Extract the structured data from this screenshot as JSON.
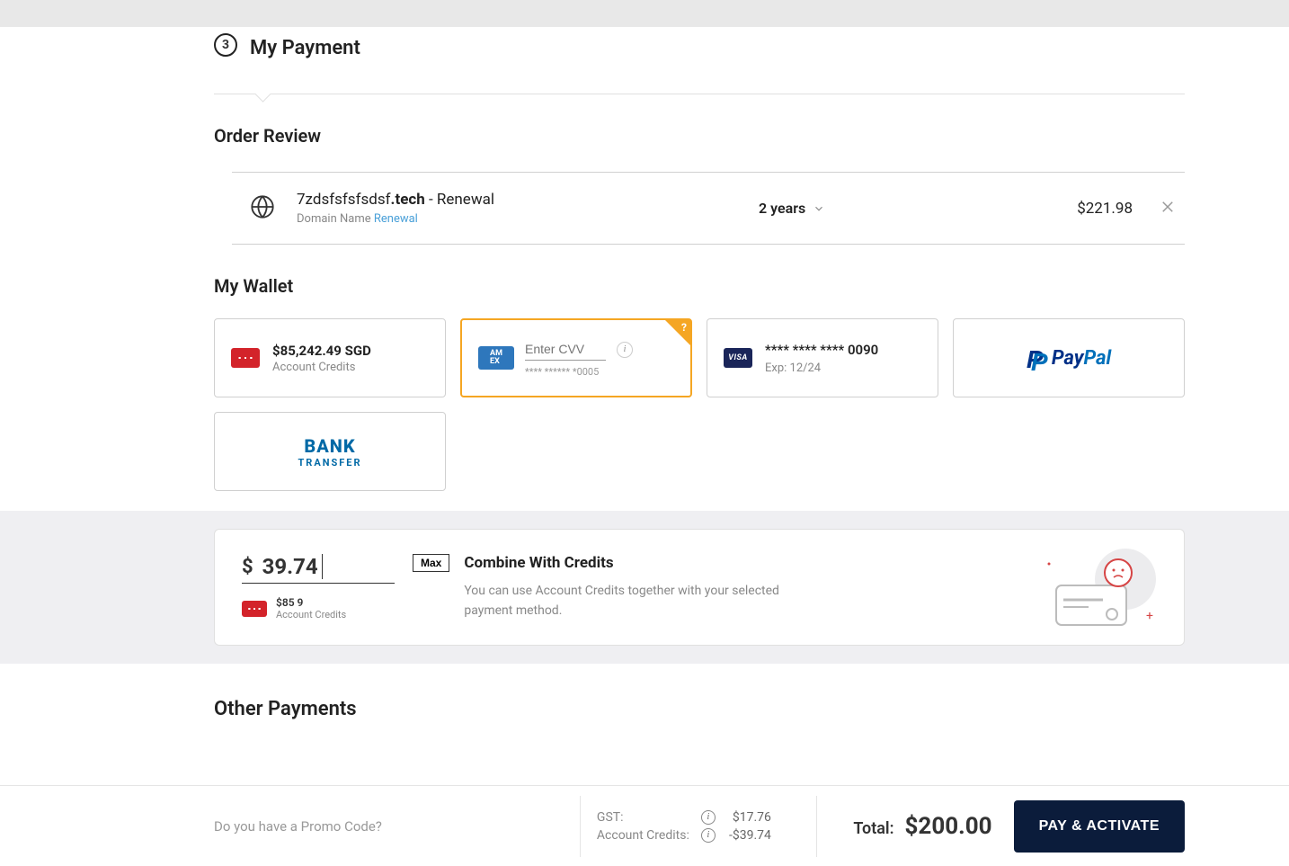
{
  "step": {
    "number": "3",
    "title": "My Payment"
  },
  "order": {
    "section_title": "Order Review",
    "item": {
      "domain_prefix": "7zdsfsfsfsdsf",
      "domain_bold": ".tech",
      "suffix": " - Renewal",
      "sub_label": "Domain Name ",
      "sub_link": "Renewal",
      "duration": "2 years",
      "price": "$221.98"
    }
  },
  "wallet": {
    "title": "My Wallet",
    "credits": {
      "amount": "$85,242.49 SGD",
      "label": "Account Credits"
    },
    "amex": {
      "cvv_placeholder": "Enter CVV",
      "mask": "**** ****** *0005"
    },
    "visa": {
      "mask": "**** **** **** 0090",
      "exp": "Exp: 12/24"
    },
    "paypal": {
      "p1": "Pay",
      "p2": "Pal"
    },
    "bank": {
      "line1": "BANK",
      "line2": "TRANSFER"
    }
  },
  "combine": {
    "currency": "$",
    "amount": "39.74",
    "max": "Max",
    "mini_balance": "$85       9",
    "mini_label": "Account Credits",
    "title": "Combine With Credits",
    "desc": "You can use Account Credits together with your selected payment method."
  },
  "other": {
    "title": "Other Payments"
  },
  "footer": {
    "promo": "Do you have a Promo Code?",
    "gst_label": "GST:",
    "gst_amount": "$17.76",
    "credits_label": "Account Credits:",
    "credits_amount": "-$39.74",
    "total_label": "Total:",
    "total_value": "$200.00",
    "pay_button": "PAY & ACTIVATE"
  }
}
